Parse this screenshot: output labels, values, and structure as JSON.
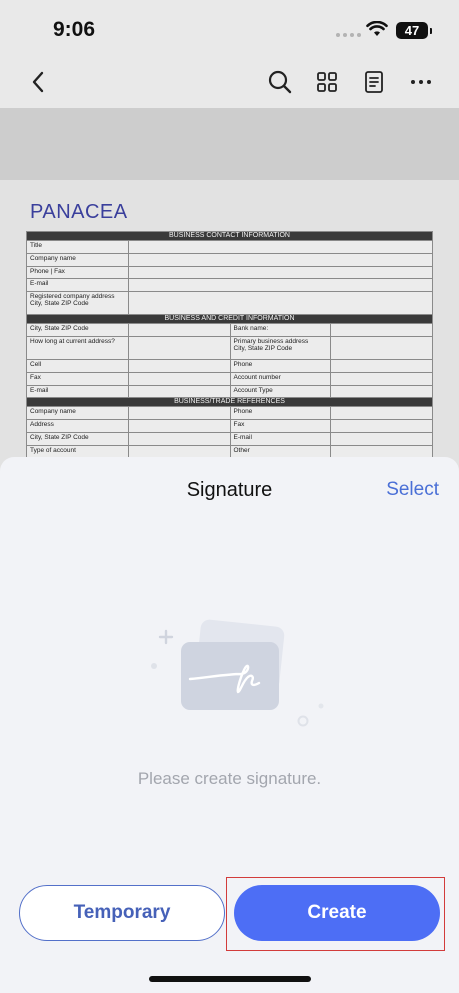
{
  "status": {
    "time": "9:06",
    "battery": "47"
  },
  "toolbar": {
    "back": "chevron-left-icon",
    "search": "search-icon",
    "grid": "grid-icon",
    "doc": "document-icon",
    "more": "more-icon"
  },
  "document": {
    "brand": "PANACEA",
    "sections": {
      "contact": "BUSINESS CONTACT INFORMATION",
      "credit": "BUSINESS AND CREDIT INFORMATION",
      "refs": "BUSINESS/TRADE REFERENCES"
    },
    "contact_rows": [
      "Title",
      "Company name",
      "Phone | Fax",
      "E-mail"
    ],
    "registered_1": "Registered company address",
    "registered_2": "City, State ZIP Code",
    "credit_rows": [
      {
        "left": "City, State ZIP Code",
        "right": "Bank name:"
      },
      {
        "left": "How long at current address?",
        "right": "Primary business address",
        "right2": "City, State ZIP Code"
      },
      {
        "left": "Cell",
        "right": "Phone"
      },
      {
        "left": "Fax",
        "right": "Account number"
      },
      {
        "left": "E-mail",
        "right": "Account Type"
      }
    ],
    "ref_rows": [
      {
        "left": "Company name",
        "right": "Phone"
      },
      {
        "left": "Address",
        "right": "Fax"
      },
      {
        "left": "City, State ZIP Code",
        "right": "E-mail"
      },
      {
        "left": "Type of account",
        "right": "Other"
      }
    ]
  },
  "sheet": {
    "title": "Signature",
    "select": "Select",
    "empty_text": "Please create signature.",
    "temporary": "Temporary",
    "create": "Create"
  },
  "colors": {
    "accent": "#4d6ef5",
    "select": "#4a6fd6",
    "brand": "#3a3f9c"
  }
}
